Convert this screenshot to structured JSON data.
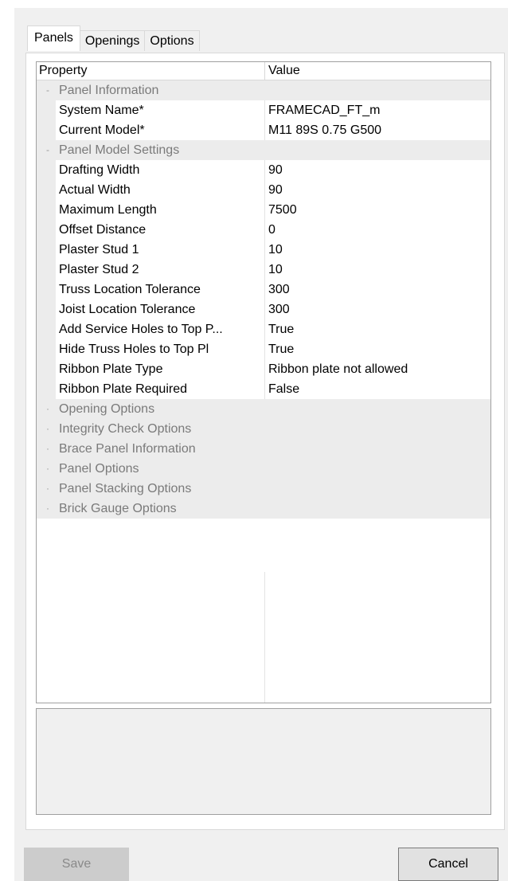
{
  "tabs": [
    "Panels",
    "Openings",
    "Options"
  ],
  "grid": {
    "col_property": "Property",
    "col_value": "Value",
    "categories": {
      "panel_info": "Panel Information",
      "panel_model": "Panel Model Settings",
      "collapsed": [
        "Opening Options",
        "Integrity Check Options",
        "Brace Panel Information",
        "Panel Options",
        "Panel Stacking Options",
        "Brick Gauge Options"
      ]
    },
    "panel_info_rows": [
      {
        "name": "System Name*",
        "value": "FRAMECAD_FT_m"
      },
      {
        "name": "Current Model*",
        "value": "M11 89S 0.75 G500"
      }
    ],
    "panel_model_rows": [
      {
        "name": "Drafting Width",
        "value": "90"
      },
      {
        "name": "Actual Width",
        "value": "90"
      },
      {
        "name": "Maximum Length",
        "value": "7500"
      },
      {
        "name": "Offset Distance",
        "value": "0"
      },
      {
        "name": "Plaster Stud 1",
        "value": "10"
      },
      {
        "name": "Plaster Stud 2",
        "value": "10"
      },
      {
        "name": "Truss Location Tolerance",
        "value": "300"
      },
      {
        "name": "Joist Location Tolerance",
        "value": "300"
      },
      {
        "name": "Add Service Holes to Top P...",
        "value": "True"
      },
      {
        "name": "Hide Truss Holes to Top Pl",
        "value": "True"
      },
      {
        "name": "Ribbon Plate Type",
        "value": "Ribbon plate not allowed"
      },
      {
        "name": "Ribbon Plate Required",
        "value": "False"
      }
    ],
    "expanded_glyph": "-",
    "collapsed_glyph": "·"
  },
  "buttons": {
    "save": "Save",
    "cancel": "Cancel"
  }
}
